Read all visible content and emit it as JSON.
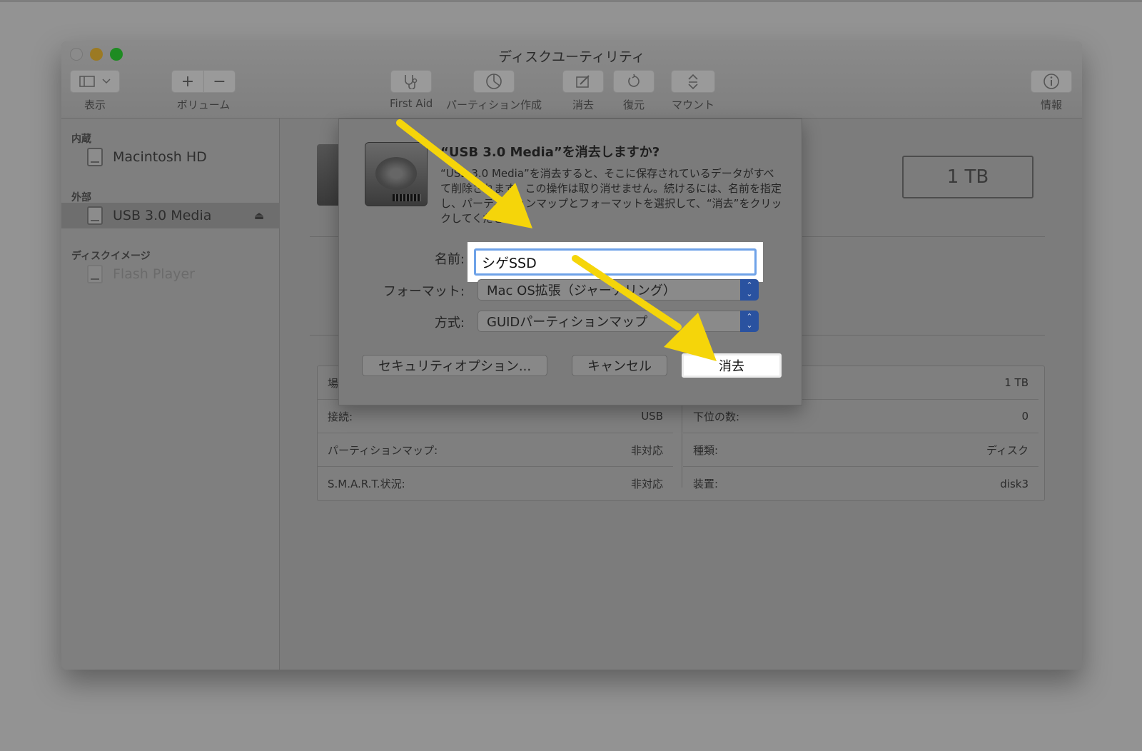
{
  "window": {
    "title": "ディスクユーティリティ"
  },
  "toolbar": {
    "view_label": "表示",
    "volume_label": "ボリューム",
    "volume_add": "+",
    "volume_remove": "−",
    "first_aid_label": "First Aid",
    "partition_label": "パーティション作成",
    "erase_label": "消去",
    "restore_label": "復元",
    "mount_label": "マウント",
    "info_label": "情報"
  },
  "sidebar": {
    "sections": [
      {
        "title": "内蔵",
        "items": [
          {
            "label": "Macintosh HD",
            "icon": "disk-icon"
          }
        ]
      },
      {
        "title": "外部",
        "items": [
          {
            "label": "USB 3.0 Media",
            "icon": "disk-icon",
            "selected": true
          }
        ]
      },
      {
        "title": "ディスクイメージ",
        "items": [
          {
            "label": "Flash Player",
            "icon": "disk-icon",
            "dimmed": true
          }
        ]
      }
    ],
    "eject_glyph": "⏏"
  },
  "main": {
    "capacity": "1 TB",
    "info_left": [
      {
        "label": "場",
        "value": ""
      },
      {
        "label": "接続:",
        "value": "USB"
      },
      {
        "label": "パーティションマップ:",
        "value": "非対応"
      },
      {
        "label": "S.M.A.R.T.状況:",
        "value": "非対応"
      }
    ],
    "info_right": [
      {
        "label": "",
        "value": "1 TB"
      },
      {
        "label": "下位の数:",
        "value": "0"
      },
      {
        "label": "種類:",
        "value": "ディスク"
      },
      {
        "label": "装置:",
        "value": "disk3"
      }
    ]
  },
  "dialog": {
    "title": "“USB 3.0 Media”を消去しますか?",
    "message": "“USB 3.0 Media”を消去すると、そこに保存されているデータがすべて削除されます。この操作は取り消せません。続けるには、名前を指定し、パーティションマップとフォーマットを選択して、“消去”をクリックしてください。",
    "name_label": "名前:",
    "name_value": "シゲSSD",
    "format_label": "フォーマット:",
    "format_value": "Mac OS拡張（ジャーナリング）",
    "scheme_label": "方式:",
    "scheme_value": "GUIDパーティションマップ",
    "security_button": "セキュリティオプション...",
    "cancel_button": "キャンセル",
    "erase_button": "消去"
  },
  "colors": {
    "annotation_arrow": "#f5d50a",
    "focus_ring": "#6ea2e8",
    "select_accent": "#2a52a0"
  }
}
